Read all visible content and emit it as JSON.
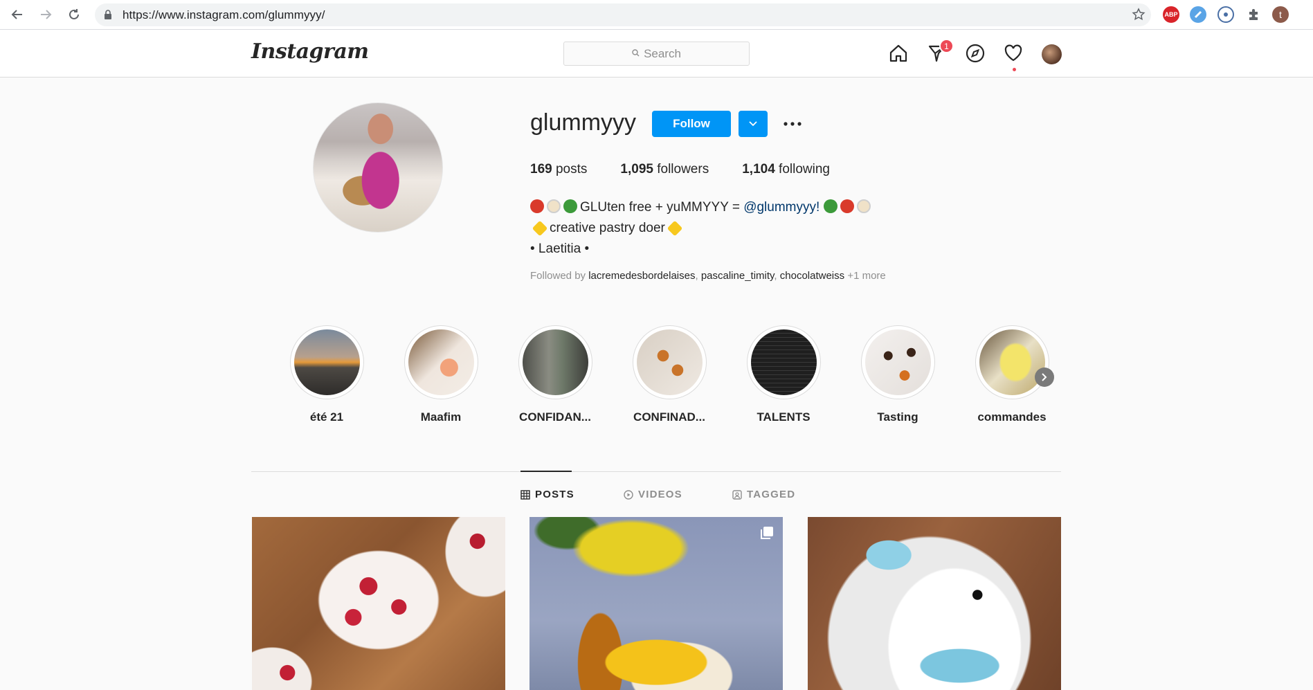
{
  "browser": {
    "url": "https://www.instagram.com/glummyyy/",
    "extensions": [
      "ABP",
      "t"
    ]
  },
  "header": {
    "logo": "Instagram",
    "search_placeholder": "Search",
    "activity_badge": "1"
  },
  "profile": {
    "username": "glummyyy",
    "follow_label": "Follow",
    "stats": {
      "posts_count": "169",
      "posts_label": "posts",
      "followers_count": "1,095",
      "followers_label": "followers",
      "following_count": "1,104",
      "following_label": "following"
    },
    "bio": {
      "line1_text": "GLUten free + yuMMYYY = ",
      "line1_mention": "@glummyyy!",
      "line2_text": "creative pastry doer",
      "line3_text": "• Laetitia •"
    },
    "followed_by": {
      "prefix": "Followed by",
      "accounts": [
        "lacremedesbordelaises",
        "pascaline_timity",
        "chocolatweiss"
      ],
      "more": "+1 more"
    }
  },
  "highlights": [
    {
      "label": "été 21"
    },
    {
      "label": "Maafim"
    },
    {
      "label": "CONFIDAN..."
    },
    {
      "label": "CONFINAD..."
    },
    {
      "label": "TALENTS"
    },
    {
      "label": "Tasting"
    },
    {
      "label": "commandes"
    }
  ],
  "tabs": [
    {
      "label": "POSTS",
      "active": true
    },
    {
      "label": "VIDEOS",
      "active": false
    },
    {
      "label": "TAGGED",
      "active": false
    }
  ],
  "colors": {
    "accent": "#0095f6",
    "badge": "#ed4956",
    "text": "#262626",
    "muted": "#8e8e8e"
  }
}
